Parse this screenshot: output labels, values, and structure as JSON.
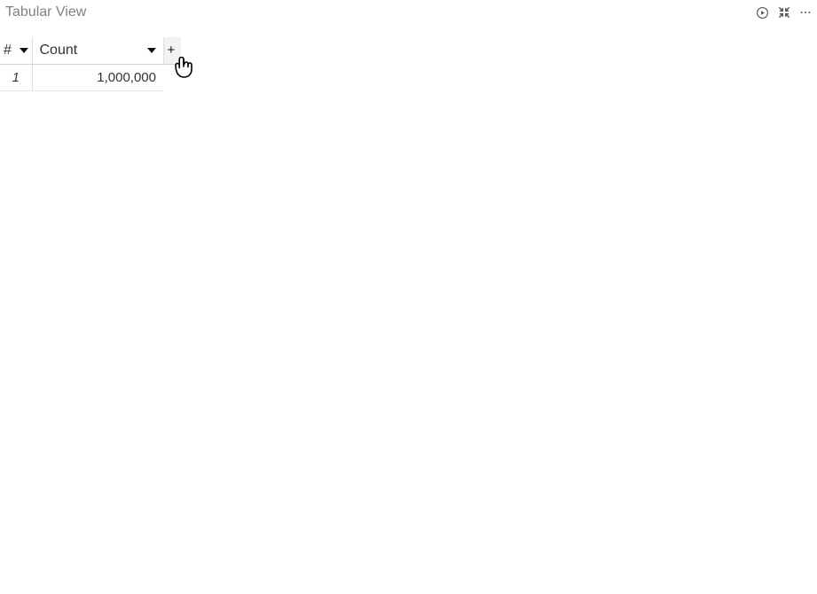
{
  "header": {
    "title": "Tabular View"
  },
  "table": {
    "columns": {
      "row_header_symbol": "#",
      "count_label": "Count"
    },
    "rows": [
      {
        "index": "1",
        "count": "1,000,000"
      }
    ],
    "add_column_symbol": "+"
  }
}
